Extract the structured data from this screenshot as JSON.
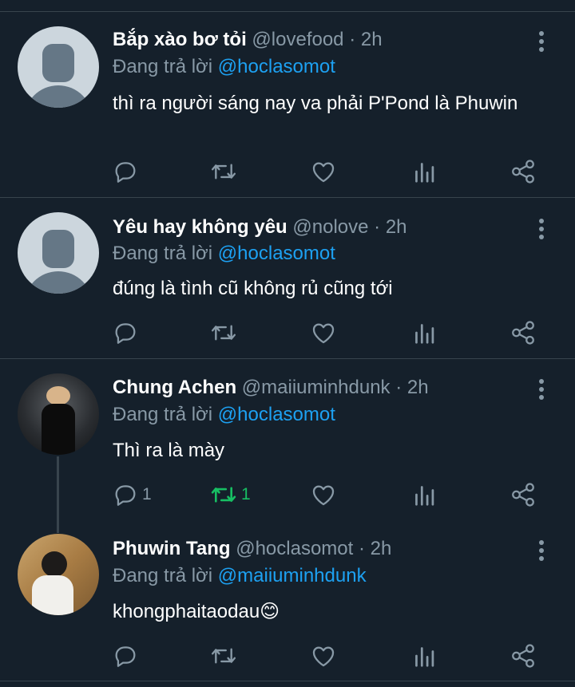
{
  "tweets": [
    {
      "name": "Bắp xào bơ tỏi",
      "handle": "@lovefood",
      "time": "· 2h",
      "reply_prefix": "Đang trả lời",
      "reply_to": "@hoclasomot",
      "text": "thì ra người sáng nay va phải P'Pond là Phuwin",
      "avatar": "default-avatar",
      "replies": "",
      "retweets": ""
    },
    {
      "name": "Yêu hay không yêu",
      "handle": "@nolove",
      "time": "· 2h",
      "reply_prefix": "Đang trả lời",
      "reply_to": "@hoclasomot",
      "text": "đúng là tình cũ không rủ cũng tới",
      "avatar": "default-avatar",
      "replies": "",
      "retweets": ""
    },
    {
      "name": "Chung Achen",
      "handle": "@maiiuminhdunk",
      "time": "· 2h",
      "reply_prefix": "Đang trả lời",
      "reply_to": "@hoclasomot",
      "text": "Thì ra là mày",
      "avatar": "photo-avatar",
      "replies": "1",
      "retweets": "1"
    },
    {
      "name": "Phuwin Tang",
      "handle": "@hoclasomot",
      "time": "· 2h",
      "reply_prefix": "Đang trả lời",
      "reply_to": "@maiiuminhdunk",
      "text": "khongphaitaodau😊",
      "avatar": "photo-avatar",
      "replies": "",
      "retweets": ""
    }
  ],
  "icons": [
    "reply-icon",
    "retweet-icon",
    "like-icon",
    "analytics-icon",
    "share-icon",
    "more-icon"
  ],
  "colors": {
    "background": "#15202b",
    "secondary_text": "#8899a6",
    "link": "#1da1f2",
    "retweet_active": "#17bf63",
    "divider": "#38444d"
  }
}
